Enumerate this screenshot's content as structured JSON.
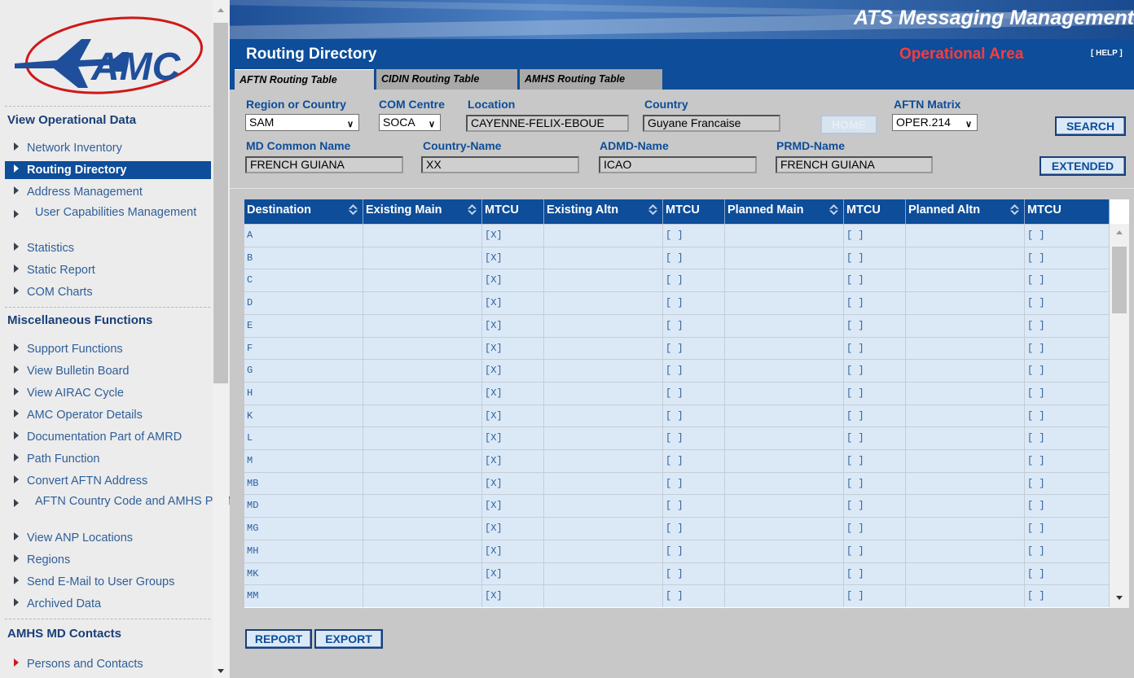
{
  "app": {
    "title": "ATS Messaging Management",
    "logo_text": "AMC"
  },
  "sidebar": {
    "sections": [
      {
        "heading": "View Operational Data",
        "items": [
          "Network Inventory",
          "Routing Directory",
          "Address Management",
          "User Capabilities Management",
          "Statistics",
          "Static Report",
          "COM Charts"
        ]
      },
      {
        "heading": "Miscellaneous Functions",
        "items": [
          "Support Functions",
          "View Bulletin Board",
          "View AIRAC Cycle",
          "AMC Operator Details",
          "Documentation Part of AMRD",
          "Path Function",
          "Convert AFTN Address",
          "AFTN Country Code and AMHS PRMD",
          "View ANP Locations",
          "Regions",
          "Send E-Mail to User Groups",
          "Archived Data"
        ]
      },
      {
        "heading": "AMHS MD Contacts",
        "items": [
          "Persons and Contacts"
        ]
      }
    ],
    "active_item": "Routing Directory"
  },
  "header": {
    "page_title": "Routing Directory",
    "area": "Operational Area",
    "help": "[ HELP ]"
  },
  "tabs": [
    "AFTN Routing Table",
    "CIDIN Routing Table",
    "AMHS Routing Table"
  ],
  "form": {
    "region_label": "Region or Country",
    "region_value": "SAM",
    "com_label": "COM Centre",
    "com_value": "SOCA",
    "location_label": "Location",
    "location_value": "CAYENNE-FELIX-EBOUE",
    "country_label": "Country",
    "country_value": "Guyane Francaise",
    "home_button": "HOME",
    "matrix_label": "AFTN Matrix",
    "matrix_value": "OPER.214",
    "search_button": "SEARCH",
    "md_label": "MD Common Name",
    "md_value": "FRENCH GUIANA",
    "cname_label": "Country-Name",
    "cname_value": "XX",
    "admd_label": "ADMD-Name",
    "admd_value": "ICAO",
    "prmd_label": "PRMD-Name",
    "prmd_value": "FRENCH GUIANA",
    "extended_button": "EXTENDED"
  },
  "table": {
    "columns": [
      "Destination",
      "Existing Main",
      "MTCU",
      "Existing Altn",
      "MTCU",
      "Planned Main",
      "MTCU",
      "Planned Altn",
      "MTCU"
    ],
    "rows": [
      [
        "A",
        "",
        "[X]",
        "",
        "[ ]",
        "",
        "[ ]",
        "",
        "[ ]"
      ],
      [
        "B",
        "",
        "[X]",
        "",
        "[ ]",
        "",
        "[ ]",
        "",
        "[ ]"
      ],
      [
        "C",
        "",
        "[X]",
        "",
        "[ ]",
        "",
        "[ ]",
        "",
        "[ ]"
      ],
      [
        "D",
        "",
        "[X]",
        "",
        "[ ]",
        "",
        "[ ]",
        "",
        "[ ]"
      ],
      [
        "E",
        "",
        "[X]",
        "",
        "[ ]",
        "",
        "[ ]",
        "",
        "[ ]"
      ],
      [
        "F",
        "",
        "[X]",
        "",
        "[ ]",
        "",
        "[ ]",
        "",
        "[ ]"
      ],
      [
        "G",
        "",
        "[X]",
        "",
        "[ ]",
        "",
        "[ ]",
        "",
        "[ ]"
      ],
      [
        "H",
        "",
        "[X]",
        "",
        "[ ]",
        "",
        "[ ]",
        "",
        "[ ]"
      ],
      [
        "K",
        "",
        "[X]",
        "",
        "[ ]",
        "",
        "[ ]",
        "",
        "[ ]"
      ],
      [
        "L",
        "",
        "[X]",
        "",
        "[ ]",
        "",
        "[ ]",
        "",
        "[ ]"
      ],
      [
        "M",
        "",
        "[X]",
        "",
        "[ ]",
        "",
        "[ ]",
        "",
        "[ ]"
      ],
      [
        "MB",
        "",
        "[X]",
        "",
        "[ ]",
        "",
        "[ ]",
        "",
        "[ ]"
      ],
      [
        "MD",
        "",
        "[X]",
        "",
        "[ ]",
        "",
        "[ ]",
        "",
        "[ ]"
      ],
      [
        "MG",
        "",
        "[X]",
        "",
        "[ ]",
        "",
        "[ ]",
        "",
        "[ ]"
      ],
      [
        "MH",
        "",
        "[X]",
        "",
        "[ ]",
        "",
        "[ ]",
        "",
        "[ ]"
      ],
      [
        "MK",
        "",
        "[X]",
        "",
        "[ ]",
        "",
        "[ ]",
        "",
        "[ ]"
      ],
      [
        "MM",
        "",
        "[X]",
        "",
        "[ ]",
        "",
        "[ ]",
        "",
        "[ ]"
      ]
    ]
  },
  "footer": {
    "report_button": "REPORT",
    "export_button": "EXPORT"
  },
  "colors": {
    "primary": "#0d4d99",
    "alert": "#ff3b3b",
    "cell": "#dbe9f7",
    "page": "#c8c8c8"
  }
}
